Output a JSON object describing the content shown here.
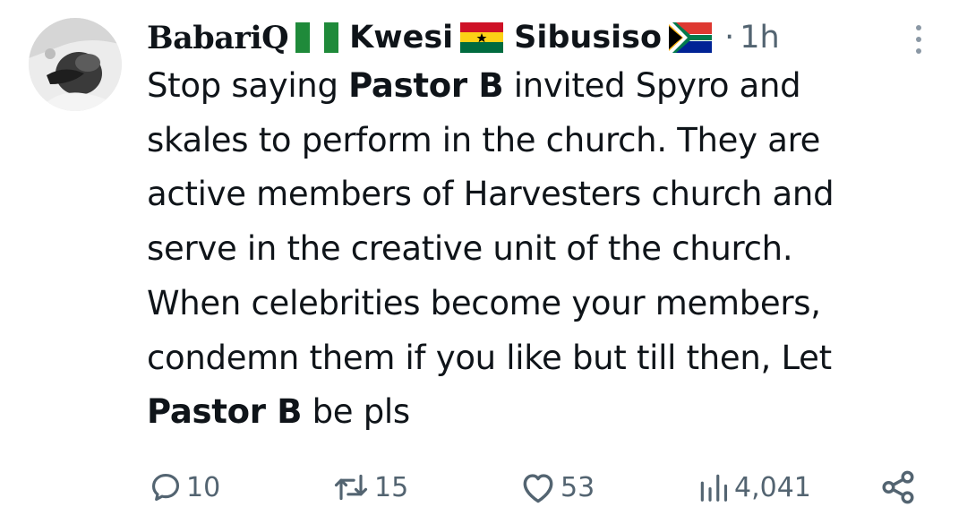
{
  "author": {
    "name_parts": [
      "BabariQ",
      "Kwesi",
      "Sibusiso"
    ],
    "flags": [
      "nigeria-flag",
      "ghana-flag",
      "south-africa-flag"
    ],
    "separator": "·",
    "time": "1h"
  },
  "tweet": {
    "lines": [
      [
        "Stop saying ",
        "Pastor B",
        " invited Spyro and"
      ],
      [
        "skales to perform in the church. They are"
      ],
      [
        "active members of Harvesters church and"
      ],
      [
        "serve in the creative unit of the church."
      ],
      [
        "When celebrities become your members,"
      ],
      [
        "condemn them if you like but till then, Let"
      ],
      [
        "Pastor B",
        " be pls"
      ]
    ]
  },
  "actions": {
    "replies": "10",
    "reposts": "15",
    "likes": "53",
    "views": "4,041"
  },
  "colors": {
    "text": "#0f1419",
    "secondary": "#536471"
  }
}
